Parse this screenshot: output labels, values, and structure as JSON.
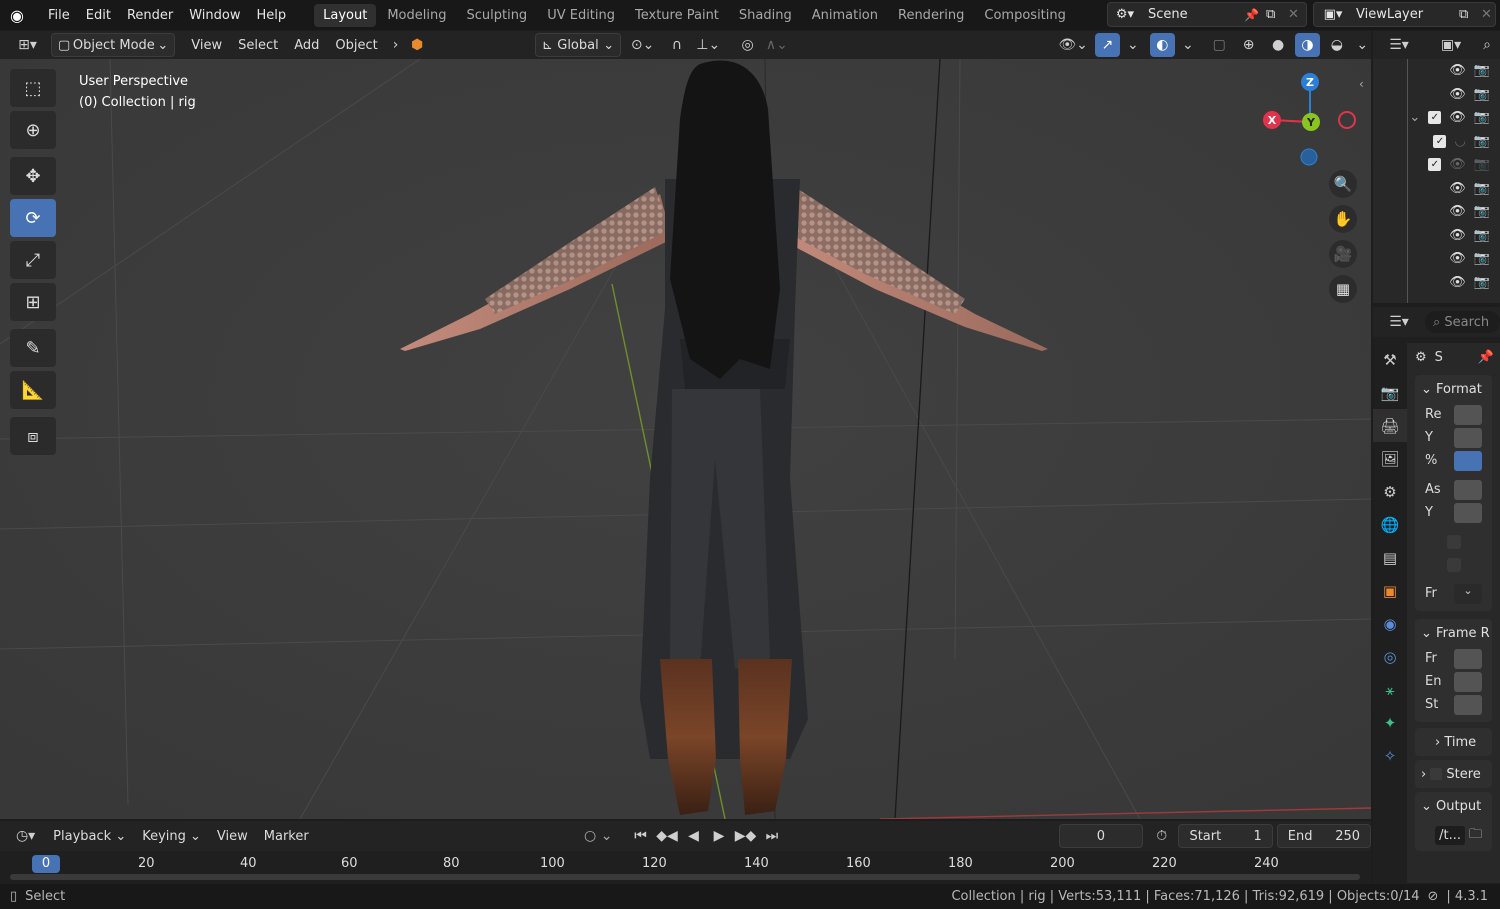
{
  "topbar": {
    "menus": [
      "File",
      "Edit",
      "Render",
      "Window",
      "Help"
    ],
    "workspaces": [
      "Layout",
      "Modeling",
      "Sculpting",
      "UV Editing",
      "Texture Paint",
      "Shading",
      "Animation",
      "Rendering",
      "Compositing"
    ],
    "active_workspace": "Layout",
    "scene_name": "Scene",
    "view_layer": "ViewLayer"
  },
  "viewport_header": {
    "mode": "Object Mode",
    "menus": [
      "View",
      "Select",
      "Add",
      "Object"
    ],
    "transform_orientation": "Global"
  },
  "viewport": {
    "info_line1": "User Perspective",
    "info_line2": "(0) Collection | rig",
    "gizmo": {
      "x": "X",
      "y": "Y",
      "z": "Z"
    }
  },
  "tools": [
    "select-box",
    "cursor",
    "move",
    "rotate",
    "scale",
    "transform",
    "annotate",
    "measure",
    "add-cube"
  ],
  "active_tool": "rotate",
  "properties": {
    "search_placeholder": "Search",
    "context_tab": "S",
    "format_panel": {
      "title": "Format",
      "rows": [
        "Re",
        "Y",
        "%",
        "As",
        "Y",
        "",
        "",
        "Fr"
      ]
    },
    "frame_range_panel": {
      "title": "Frame R",
      "rows": [
        "Fr",
        "En",
        "St"
      ]
    },
    "time_panel": "Time",
    "stereo_panel": "Stere",
    "output_panel": "Output",
    "output_path": "/t..."
  },
  "outliner": {
    "search_placeholder": "Search"
  },
  "timeline": {
    "menus": [
      "Playback",
      "Keying",
      "View",
      "Marker"
    ],
    "current_frame": "0",
    "start_label": "Start",
    "start_value": "1",
    "end_label": "End",
    "end_value": "250",
    "ruler_current": "0",
    "ruler_ticks": [
      "20",
      "40",
      "60",
      "80",
      "100",
      "120",
      "140",
      "160",
      "180",
      "200",
      "220",
      "240"
    ]
  },
  "statusbar": {
    "left": "Select",
    "stats": "Collection | rig | Verts:53,111 | Faces:71,126 | Tris:92,619 | Objects:0/14",
    "version": "4.3.1"
  },
  "colors": {
    "accent": "#4772b3",
    "x_axis": "#e0334d",
    "y_axis": "#8ac51e",
    "z_axis": "#2b80d6"
  }
}
